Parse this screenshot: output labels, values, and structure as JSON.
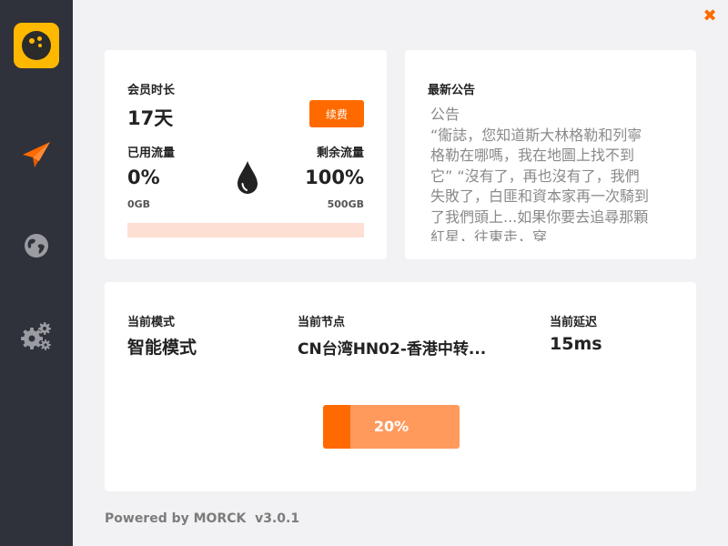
{
  "app": {
    "close_symbol": "✖",
    "colors": {
      "accent": "#ff6a00",
      "sidebar": "#2f323b",
      "logo": "#ffb800",
      "background": "#f2f2f4"
    }
  },
  "sidebar": {
    "items": [
      {
        "icon": "paper-plane-icon",
        "active": true
      },
      {
        "icon": "globe-icon",
        "active": false
      },
      {
        "icon": "gears-icon",
        "active": false
      }
    ]
  },
  "member": {
    "duration_label": "会员时长",
    "duration_value": "17天",
    "renew_label": "续费",
    "used_label": "已用流量",
    "used_percent": "0%",
    "used_amount": "0GB",
    "remaining_label": "剩余流量",
    "remaining_percent": "100%",
    "total_amount": "500GB",
    "used_fraction": 0
  },
  "notice": {
    "title": "最新公告",
    "body": "公告\n“衞誌，您知道斯大林格勒和列寧格勒在哪嗎，我在地圖上找不到它” “沒有了，再也沒有了，我們失敗了，白匪和資本家再一次騎到了我們頭上...如果你要去追尋那顆紅星，往東走，穿"
  },
  "status": {
    "mode_label": "当前模式",
    "mode_value": "智能模式",
    "node_label": "当前节点",
    "node_value": "CN台湾HN02-香港中转...",
    "latency_label": "当前延迟",
    "latency_value": "15ms",
    "progress_text": "20%",
    "progress_fraction": 0.2
  },
  "footer": {
    "text": "Powered by MORCK  v3.0.1"
  }
}
